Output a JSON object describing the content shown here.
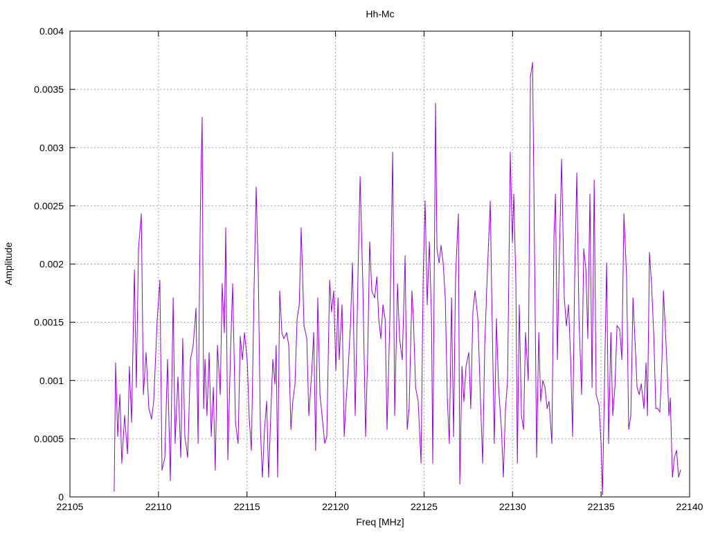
{
  "chart_data": {
    "type": "line",
    "title": "Hh-Mc",
    "xlabel": "Freq [MHz]",
    "ylabel": "Amplitude",
    "xlim": [
      22105,
      22140
    ],
    "ylim": [
      0,
      0.004
    ],
    "grid": true,
    "legend": "none",
    "x_ticks": [
      "22105",
      "22110",
      "22115",
      "22120",
      "22125",
      "22130",
      "22135",
      "22140"
    ],
    "x_tick_values": [
      22105,
      22110,
      22115,
      22120,
      22125,
      22130,
      22135,
      22140
    ],
    "y_ticks": [
      "0",
      "0.0005",
      "0.001",
      "0.0015",
      "0.002",
      "0.0025",
      "0.003",
      "0.0035",
      "0.004"
    ],
    "y_tick_values": [
      0,
      0.0005,
      0.001,
      0.0015,
      0.002,
      0.0025,
      0.003,
      0.0035,
      0.004
    ],
    "series": [
      {
        "name": "Hh-Mc",
        "color": "#9400d3",
        "x": [
          22107.5,
          22107.58,
          22107.7,
          22107.82,
          22107.93,
          22108.09,
          22108.25,
          22108.36,
          22108.48,
          22108.64,
          22108.75,
          22108.87,
          22109.03,
          22109.15,
          22109.3,
          22109.46,
          22109.61,
          22109.73,
          22109.93,
          22110.08,
          22110.2,
          22110.36,
          22110.51,
          22110.67,
          22110.83,
          22110.94,
          22111.1,
          22111.26,
          22111.37,
          22111.49,
          22111.65,
          22111.81,
          22111.96,
          22112.12,
          22112.24,
          22112.31,
          22112.39,
          22112.47,
          22112.55,
          22112.63,
          22112.74,
          22112.86,
          22112.98,
          22113.1,
          22113.21,
          22113.33,
          22113.49,
          22113.6,
          22113.72,
          22113.8,
          22113.92,
          22114.07,
          22114.19,
          22114.35,
          22114.5,
          22114.62,
          22114.74,
          22114.86,
          22115.01,
          22115.13,
          22115.25,
          22115.4,
          22115.52,
          22115.64,
          22115.76,
          22115.87,
          22115.99,
          22116.11,
          22116.22,
          22116.34,
          22116.46,
          22116.58,
          22116.65,
          22116.73,
          22116.85,
          22116.97,
          22117.08,
          22117.24,
          22117.36,
          22117.48,
          22117.59,
          22117.71,
          22117.83,
          22117.95,
          22118.06,
          22118.22,
          22118.38,
          22118.49,
          22118.65,
          22118.77,
          22118.88,
          22119.0,
          22119.12,
          22119.24,
          22119.39,
          22119.51,
          22119.67,
          22119.78,
          22119.9,
          22120.02,
          22120.14,
          22120.21,
          22120.37,
          22120.49,
          22120.6,
          22120.72,
          22120.84,
          22120.96,
          22121.11,
          22121.27,
          22121.39,
          22121.54,
          22121.7,
          22121.82,
          22121.93,
          22122.05,
          22122.21,
          22122.33,
          22122.44,
          22122.56,
          22122.68,
          22122.8,
          22122.91,
          22123.07,
          22123.23,
          22123.34,
          22123.5,
          22123.62,
          22123.77,
          22123.93,
          22124.05,
          22124.16,
          22124.32,
          22124.4,
          22124.52,
          22124.67,
          22124.83,
          22124.95,
          22125.06,
          22125.18,
          22125.3,
          22125.42,
          22125.49,
          22125.65,
          22125.73,
          22125.85,
          22125.96,
          22126.08,
          22126.2,
          22126.32,
          22126.43,
          22126.55,
          22126.67,
          22126.78,
          22126.94,
          22127.02,
          22127.14,
          22127.25,
          22127.37,
          22127.53,
          22127.64,
          22127.76,
          22127.88,
          22128.04,
          22128.19,
          22128.31,
          22128.43,
          22128.58,
          22128.74,
          22128.82,
          22128.97,
          22129.09,
          22129.21,
          22129.37,
          22129.48,
          22129.6,
          22129.72,
          22129.87,
          22129.99,
          22130.07,
          22130.19,
          22130.27,
          22130.38,
          22130.5,
          22130.62,
          22130.73,
          22130.89,
          22131.01,
          22131.13,
          22131.24,
          22131.36,
          22131.48,
          22131.59,
          22131.71,
          22131.83,
          22131.95,
          22132.06,
          22132.22,
          22132.34,
          22132.42,
          22132.53,
          22132.65,
          22132.77,
          22132.92,
          22133.04,
          22133.16,
          22133.28,
          22133.39,
          22133.51,
          22133.63,
          22133.75,
          22133.9,
          22134.02,
          22134.14,
          22134.25,
          22134.37,
          22134.49,
          22134.61,
          22134.72,
          22134.88,
          22135.0,
          22135.08,
          22135.19,
          22135.31,
          22135.43,
          22135.55,
          22135.66,
          22135.78,
          22135.9,
          22136.05,
          22136.17,
          22136.29,
          22136.44,
          22136.56,
          22136.68,
          22136.8,
          22136.91,
          22137.03,
          22137.15,
          22137.27,
          22137.42,
          22137.54,
          22137.62,
          22137.73,
          22137.85,
          22137.97,
          22138.09,
          22138.2,
          22138.32,
          22138.44,
          22138.52,
          22138.6,
          22138.71,
          22138.83,
          22138.91,
          22139.03,
          22139.14,
          22139.26,
          22139.38,
          22139.49
        ],
        "y": [
          5e-05,
          0.00115,
          0.00052,
          0.00088,
          0.00029,
          0.0007,
          0.00037,
          0.00112,
          0.00064,
          0.00195,
          0.00094,
          0.00213,
          0.00243,
          0.00088,
          0.00124,
          0.00076,
          0.00067,
          0.00082,
          0.00153,
          0.00186,
          0.00023,
          0.00034,
          0.00118,
          0.00014,
          0.00171,
          0.00046,
          0.00103,
          0.00034,
          0.00136,
          0.00052,
          0.00034,
          0.00118,
          0.0013,
          0.00162,
          0.00046,
          0.00171,
          0.00272,
          0.00326,
          0.00076,
          0.00118,
          0.0007,
          0.00124,
          0.00052,
          0.00094,
          0.00023,
          0.0013,
          0.00088,
          0.00183,
          0.00141,
          0.00231,
          0.00032,
          0.00124,
          0.00183,
          0.00064,
          0.00046,
          0.00138,
          0.00118,
          0.00141,
          0.00118,
          0.00067,
          0.0004,
          0.00177,
          0.00266,
          0.00189,
          0.00058,
          0.00017,
          0.00058,
          0.00082,
          0.00017,
          0.0007,
          0.00118,
          0.00097,
          0.0013,
          0.00017,
          0.00177,
          0.00141,
          0.00136,
          0.00141,
          0.0013,
          0.00058,
          0.00082,
          0.00097,
          0.00153,
          0.00165,
          0.00231,
          0.00147,
          0.00136,
          0.0007,
          0.00106,
          0.00141,
          0.0004,
          0.00171,
          0.00088,
          0.0007,
          0.00046,
          0.00052,
          0.00186,
          0.00159,
          0.00177,
          0.00109,
          0.00171,
          0.00118,
          0.00165,
          0.00052,
          0.00082,
          0.00112,
          0.00147,
          0.00201,
          0.0007,
          0.00189,
          0.00275,
          0.00183,
          0.00052,
          0.00124,
          0.00219,
          0.00177,
          0.00171,
          0.00189,
          0.00153,
          0.00136,
          0.00165,
          0.00153,
          0.00058,
          0.00153,
          0.00296,
          0.0007,
          0.00183,
          0.00136,
          0.00118,
          0.00207,
          0.00058,
          0.00076,
          0.00177,
          0.00153,
          0.00094,
          0.00082,
          0.00029,
          0.00189,
          0.00254,
          0.00165,
          0.00219,
          0.00153,
          0.00029,
          0.00338,
          0.00213,
          0.00201,
          0.00216,
          0.00201,
          0.00171,
          0.00082,
          0.00046,
          0.00171,
          0.00052,
          0.00189,
          0.00243,
          0.00011,
          0.00112,
          0.00082,
          0.00112,
          0.00124,
          0.00076,
          0.00159,
          0.00177,
          0.00153,
          0.00082,
          0.00029,
          0.0013,
          0.00195,
          0.00254,
          0.00177,
          0.00046,
          0.00153,
          0.00094,
          0.00058,
          0.00017,
          0.00076,
          0.001,
          0.00296,
          0.00219,
          0.0026,
          0.00183,
          0.00029,
          0.00165,
          0.0007,
          0.00058,
          0.00141,
          0.001,
          0.00361,
          0.00373,
          0.00213,
          0.00034,
          0.00141,
          0.00082,
          0.001,
          0.00094,
          0.00076,
          0.00082,
          0.00046,
          0.00225,
          0.0026,
          0.00118,
          0.00213,
          0.0029,
          0.00171,
          0.00147,
          0.00165,
          0.00118,
          0.00052,
          0.00189,
          0.00278,
          0.00153,
          0.00088,
          0.00213,
          0.00195,
          0.00136,
          0.0026,
          0.00094,
          0.00272,
          0.00088,
          0.00079,
          0.00046,
          2e-05,
          0.00094,
          0.00201,
          0.00046,
          0.00141,
          0.0007,
          0.00094,
          0.00147,
          0.00144,
          0.00118,
          0.00243,
          0.00189,
          0.00058,
          0.0007,
          0.00171,
          0.00136,
          0.00094,
          0.00088,
          0.00097,
          0.00076,
          0.00115,
          0.0007,
          0.0021,
          0.00183,
          0.00141,
          0.00076,
          0.00076,
          0.00073,
          0.00118,
          0.00177,
          0.00153,
          0.00118,
          0.0007,
          0.00085,
          0.00017,
          0.00034,
          0.0004,
          0.00017,
          0.00023
        ]
      }
    ]
  }
}
